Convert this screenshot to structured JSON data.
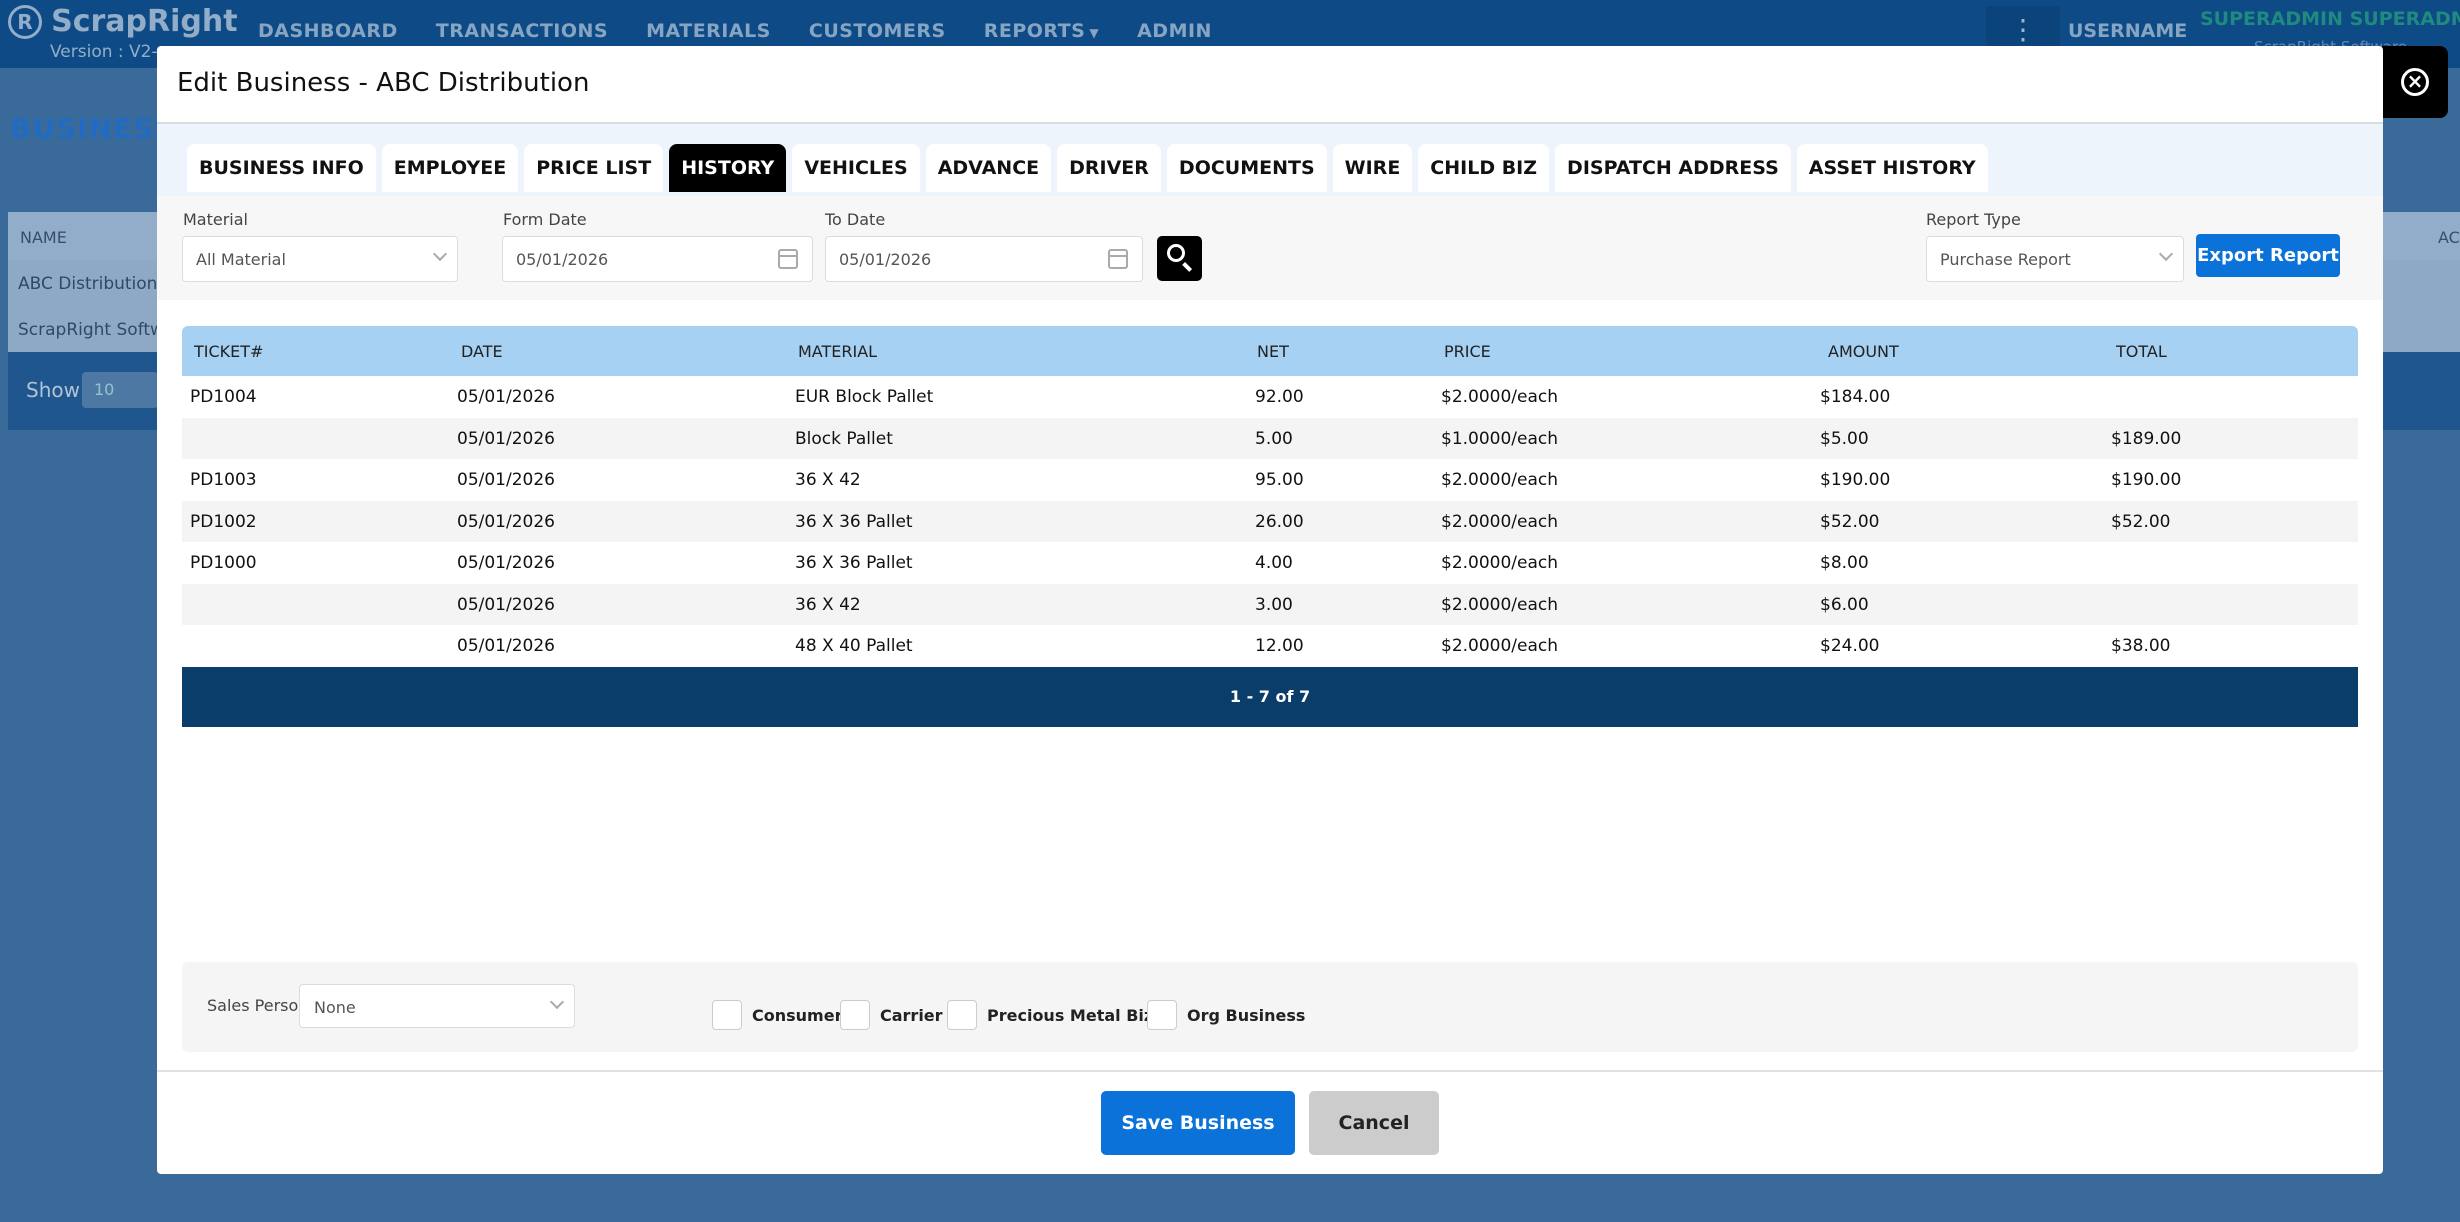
{
  "app": {
    "brand": "ScrapRight",
    "version": "Version : V2-",
    "nav": [
      "DASHBOARD",
      "TRANSACTIONS",
      "MATERIALS",
      "CUSTOMERS",
      "REPORTS",
      "ADMIN"
    ],
    "username_label": "USERNAME",
    "user_name": "SUPERADMIN SUPERADMIN",
    "user_sub": "ScrapRight Software"
  },
  "background": {
    "page_title": "BUSINESS",
    "name_header": "NAME",
    "action_header": "AC",
    "rows": [
      "ABC Distribution",
      "ScrapRight Softwa"
    ],
    "show_label": "Show",
    "show_value": "10"
  },
  "modal": {
    "title": "Edit Business - ABC Distribution",
    "tabs": [
      "BUSINESS INFO",
      "EMPLOYEE",
      "PRICE LIST",
      "HISTORY",
      "VEHICLES",
      "ADVANCE",
      "DRIVER",
      "DOCUMENTS",
      "WIRE",
      "CHILD BIZ",
      "DISPATCH ADDRESS",
      "ASSET HISTORY"
    ],
    "active_tab": "HISTORY",
    "filters": {
      "material_label": "Material",
      "material_value": "All Material",
      "from_label": "Form Date",
      "from_value": "05/01/2026",
      "to_label": "To Date",
      "to_value": "05/01/2026",
      "report_type_label": "Report Type",
      "report_type_value": "Purchase Report",
      "export_label": "Export Report"
    },
    "table": {
      "columns": [
        "TICKET#",
        "DATE",
        "MATERIAL",
        "NET",
        "PRICE",
        "AMOUNT",
        "TOTAL"
      ],
      "rows": [
        [
          "PD1004",
          "05/01/2026",
          "EUR Block Pallet",
          "92.00",
          "$2.0000/each",
          "$184.00",
          ""
        ],
        [
          "",
          "05/01/2026",
          "Block Pallet",
          "5.00",
          "$1.0000/each",
          "$5.00",
          "$189.00"
        ],
        [
          "PD1003",
          "05/01/2026",
          "36 X 42",
          "95.00",
          "$2.0000/each",
          "$190.00",
          "$190.00"
        ],
        [
          "PD1002",
          "05/01/2026",
          "36 X 36 Pallet",
          "26.00",
          "$2.0000/each",
          "$52.00",
          "$52.00"
        ],
        [
          "PD1000",
          "05/01/2026",
          "36 X 36 Pallet",
          "4.00",
          "$2.0000/each",
          "$8.00",
          ""
        ],
        [
          "",
          "05/01/2026",
          "36 X 42",
          "3.00",
          "$2.0000/each",
          "$6.00",
          ""
        ],
        [
          "",
          "05/01/2026",
          "48 X 40 Pallet",
          "12.00",
          "$2.0000/each",
          "$24.00",
          "$38.00"
        ]
      ],
      "pager": "1 - 7 of 7"
    },
    "sales_person_label": "Sales Person",
    "sales_person_value": "None",
    "checkboxes": [
      "Consumer",
      "Carrier",
      "Precious Metal Biz",
      "Org Business"
    ],
    "save_label": "Save Business",
    "cancel_label": "Cancel"
  }
}
